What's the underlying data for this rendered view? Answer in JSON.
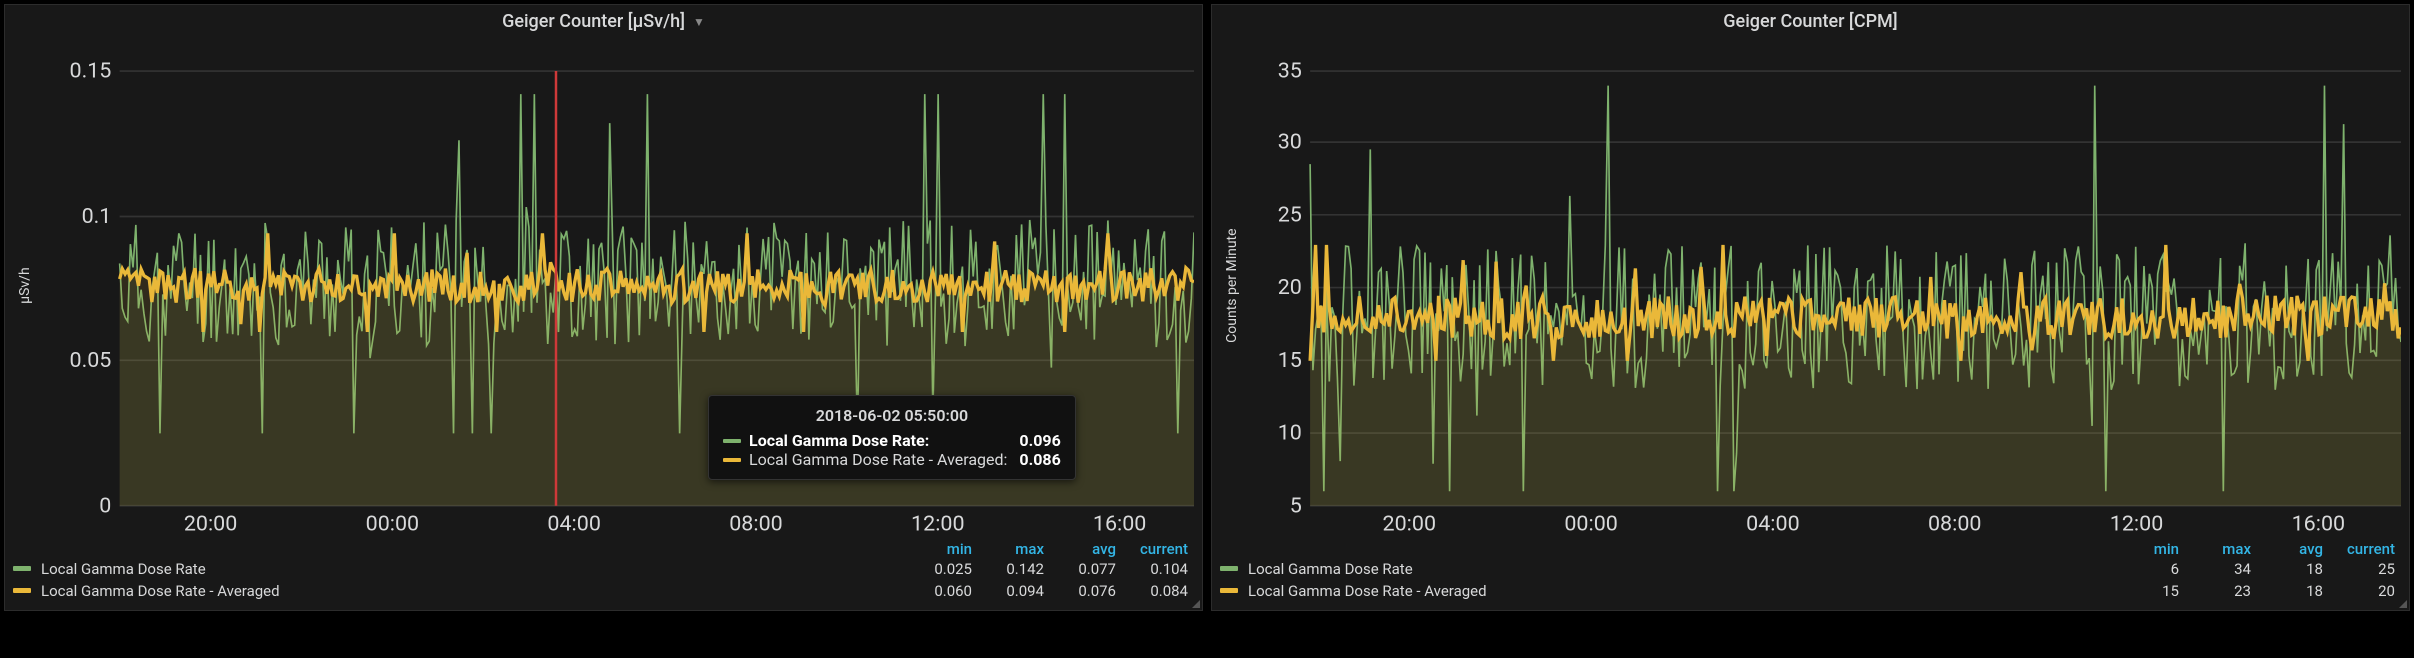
{
  "panels": [
    {
      "title": "Geiger Counter [µSv/h]",
      "has_menu": true,
      "ylabel": "µSv/h",
      "crosshair_x": 0.406,
      "tooltip": {
        "time": "2018-06-02 05:50:00",
        "rows": [
          {
            "swatch": "sw1",
            "name": "Local Gamma Dose Rate:",
            "value": "0.096",
            "highlight": true
          },
          {
            "swatch": "sw2",
            "name": "Local Gamma Dose Rate - Averaged:",
            "value": "0.086",
            "highlight": false
          }
        ],
        "pos": {
          "left_pct": 58,
          "top_pct": 72
        }
      },
      "legend_headers": [
        "min",
        "max",
        "avg",
        "current"
      ],
      "legend": [
        {
          "swatch": "sw1",
          "name": "Local Gamma Dose Rate",
          "stats": [
            "0.025",
            "0.142",
            "0.077",
            "0.104"
          ]
        },
        {
          "swatch": "sw2",
          "name": "Local Gamma Dose Rate - Averaged",
          "stats": [
            "0.060",
            "0.094",
            "0.076",
            "0.084"
          ]
        }
      ]
    },
    {
      "title": "Geiger Counter [CPM]",
      "has_menu": false,
      "ylabel": "Counts per Minute",
      "crosshair_x": null,
      "tooltip": null,
      "legend_headers": [
        "min",
        "max",
        "avg",
        "current"
      ],
      "legend": [
        {
          "swatch": "sw1",
          "name": "Local Gamma Dose Rate",
          "stats": [
            "6",
            "34",
            "18",
            "25"
          ]
        },
        {
          "swatch": "sw2",
          "name": "Local Gamma Dose Rate - Averaged",
          "stats": [
            "15",
            "23",
            "18",
            "20"
          ]
        }
      ]
    }
  ],
  "chart_data": [
    {
      "type": "line",
      "title": "Geiger Counter [µSv/h]",
      "xlabel": "",
      "ylabel": "µSv/h",
      "ylim": [
        0,
        0.15
      ],
      "y_ticks": [
        0,
        0.05,
        0.1,
        0.15
      ],
      "x_categories": [
        "20:00",
        "00:00",
        "04:00",
        "08:00",
        "12:00",
        "16:00"
      ],
      "series": [
        {
          "name": "Local Gamma Dose Rate",
          "color": "#7eb26d",
          "min": 0.025,
          "max": 0.142,
          "avg": 0.077,
          "current": 0.104
        },
        {
          "name": "Local Gamma Dose Rate - Averaged",
          "color": "#eab839",
          "min": 0.06,
          "max": 0.094,
          "avg": 0.076,
          "current": 0.084
        }
      ],
      "hover": {
        "time": "2018-06-02 05:50:00",
        "values": {
          "Local Gamma Dose Rate": 0.096,
          "Local Gamma Dose Rate - Averaged": 0.086
        }
      }
    },
    {
      "type": "line",
      "title": "Geiger Counter [CPM]",
      "xlabel": "",
      "ylabel": "Counts per Minute",
      "ylim": [
        5,
        35
      ],
      "y_ticks": [
        5,
        10,
        15,
        20,
        25,
        30,
        35
      ],
      "x_categories": [
        "20:00",
        "00:00",
        "04:00",
        "08:00",
        "12:00",
        "16:00"
      ],
      "series": [
        {
          "name": "Local Gamma Dose Rate",
          "color": "#7eb26d",
          "min": 6,
          "max": 34,
          "avg": 18,
          "current": 25
        },
        {
          "name": "Local Gamma Dose Rate - Averaged",
          "color": "#eab839",
          "min": 15,
          "max": 23,
          "avg": 18,
          "current": 20
        }
      ]
    }
  ]
}
